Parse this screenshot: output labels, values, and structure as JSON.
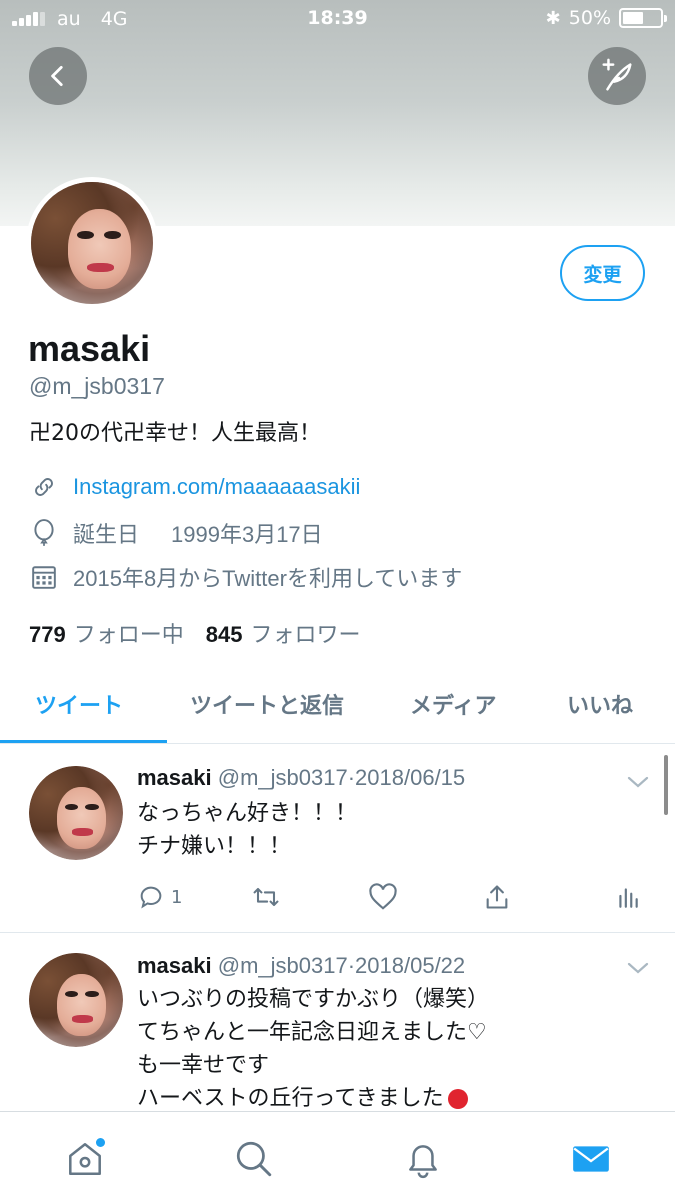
{
  "status_bar": {
    "carrier": "au",
    "network": "4G",
    "time": "18:39",
    "battery": "50%",
    "battery_level": 0.5
  },
  "header": {
    "back_icon": "chevron-left-icon",
    "compose_icon": "feather-plus-icon"
  },
  "profile": {
    "edit_label": "変更",
    "name": "masaki",
    "handle": "@m_jsb0317",
    "bio": "卍20の代卍幸せ！人生最高！",
    "link": "Instagram.com/maaaaaasakii",
    "birthday_label": "誕生日",
    "birthday": "1999年3月17日",
    "joined": "2015年8月からTwitterを利用しています",
    "following_count": "779",
    "following_label": "フォロー中",
    "followers_count": "845",
    "followers_label": "フォロワー"
  },
  "tabs": [
    {
      "label": "ツイート",
      "active": true
    },
    {
      "label": "ツイートと返信",
      "active": false
    },
    {
      "label": "メディア",
      "active": false
    },
    {
      "label": "いいね",
      "active": false
    }
  ],
  "tweets": [
    {
      "name": "masaki",
      "handle": "@m_jsb0317",
      "sep": "·",
      "date": "2018/06/15",
      "lines": [
        "なっちゃん好き！！！",
        "チナ嫌い！！！"
      ],
      "reply_count": "1"
    },
    {
      "name": "masaki",
      "handle": "@m_jsb0317",
      "sep": "·",
      "date": "2018/05/22",
      "lines": [
        "いつぶりの投稿ですかぶり（爆笑）",
        "てちゃんと一年記念日迎えました♡",
        "も一幸せです",
        "ハーベストの丘行ってきました"
      ]
    }
  ],
  "bottom_nav": [
    {
      "icon": "home-icon",
      "active": false,
      "badge": true
    },
    {
      "icon": "search-icon",
      "active": false
    },
    {
      "icon": "bell-icon",
      "active": false
    },
    {
      "icon": "mail-icon",
      "active": true
    }
  ],
  "colors": {
    "accent": "#1da1f2",
    "text": "#14171a",
    "muted": "#657786"
  }
}
